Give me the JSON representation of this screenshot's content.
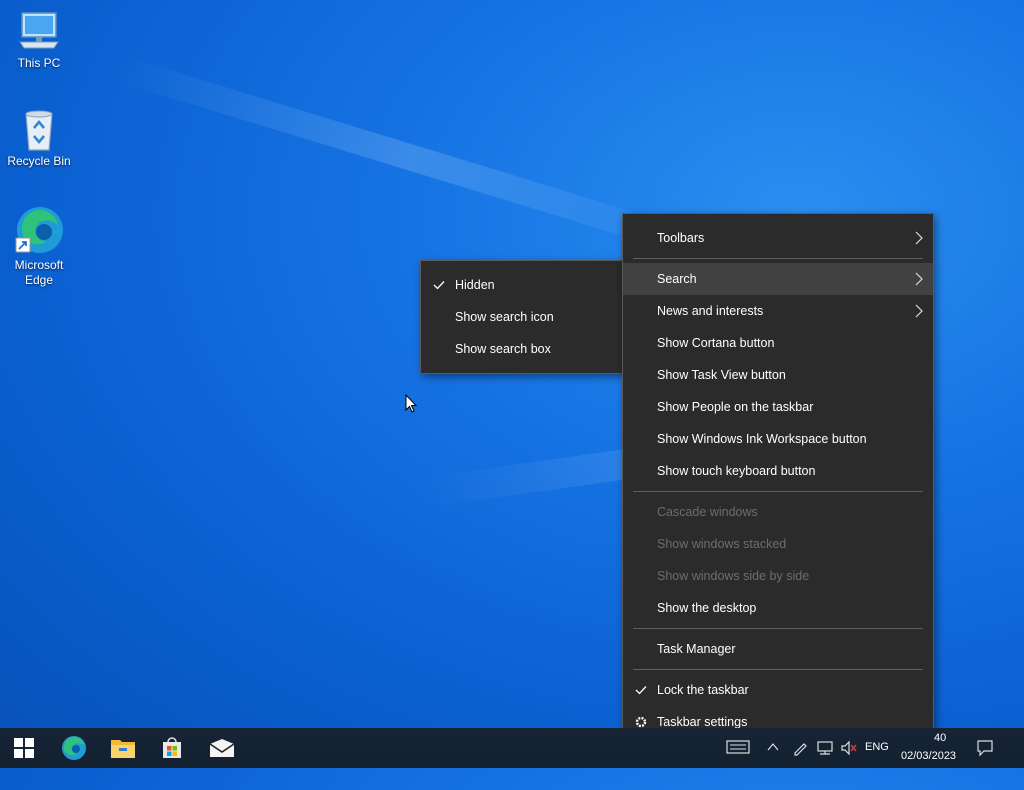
{
  "desktop": {
    "icons": [
      {
        "label": "This PC",
        "icon": "computer-icon"
      },
      {
        "label": "Recycle Bin",
        "icon": "recycle-bin-icon"
      },
      {
        "label": "Microsoft Edge",
        "icon": "edge-icon"
      }
    ]
  },
  "context_menu": {
    "items": [
      {
        "label": "Toolbars",
        "submenu": true
      },
      {
        "label": "Search",
        "submenu": true,
        "hover": true
      },
      {
        "label": "News and interests",
        "submenu": true
      },
      {
        "label": "Show Cortana button"
      },
      {
        "label": "Show Task View button"
      },
      {
        "label": "Show People on the taskbar"
      },
      {
        "label": "Show Windows Ink Workspace button"
      },
      {
        "label": "Show touch keyboard button"
      },
      {
        "label": "Cascade windows",
        "disabled": true
      },
      {
        "label": "Show windows stacked",
        "disabled": true
      },
      {
        "label": "Show windows side by side",
        "disabled": true
      },
      {
        "label": "Show the desktop"
      },
      {
        "label": "Task Manager"
      },
      {
        "label": "Lock the taskbar",
        "checked": true
      },
      {
        "label": "Taskbar settings",
        "icon": "gear-icon"
      }
    ]
  },
  "search_submenu": {
    "items": [
      {
        "label": "Hidden",
        "checked": true
      },
      {
        "label": "Show search icon"
      },
      {
        "label": "Show search box"
      }
    ]
  },
  "taskbar": {
    "pinned": [
      "start-icon",
      "edge-icon",
      "file-explorer-icon",
      "store-icon",
      "mail-icon"
    ],
    "tray": {
      "language": "ENG",
      "time_partial": "40",
      "date": "02/03/2023"
    }
  },
  "colors": {
    "menu_bg": "#2b2b2b",
    "menu_hover": "#414141",
    "disabled_text": "#6d6d6d",
    "taskbar_bg": "#14212f"
  }
}
